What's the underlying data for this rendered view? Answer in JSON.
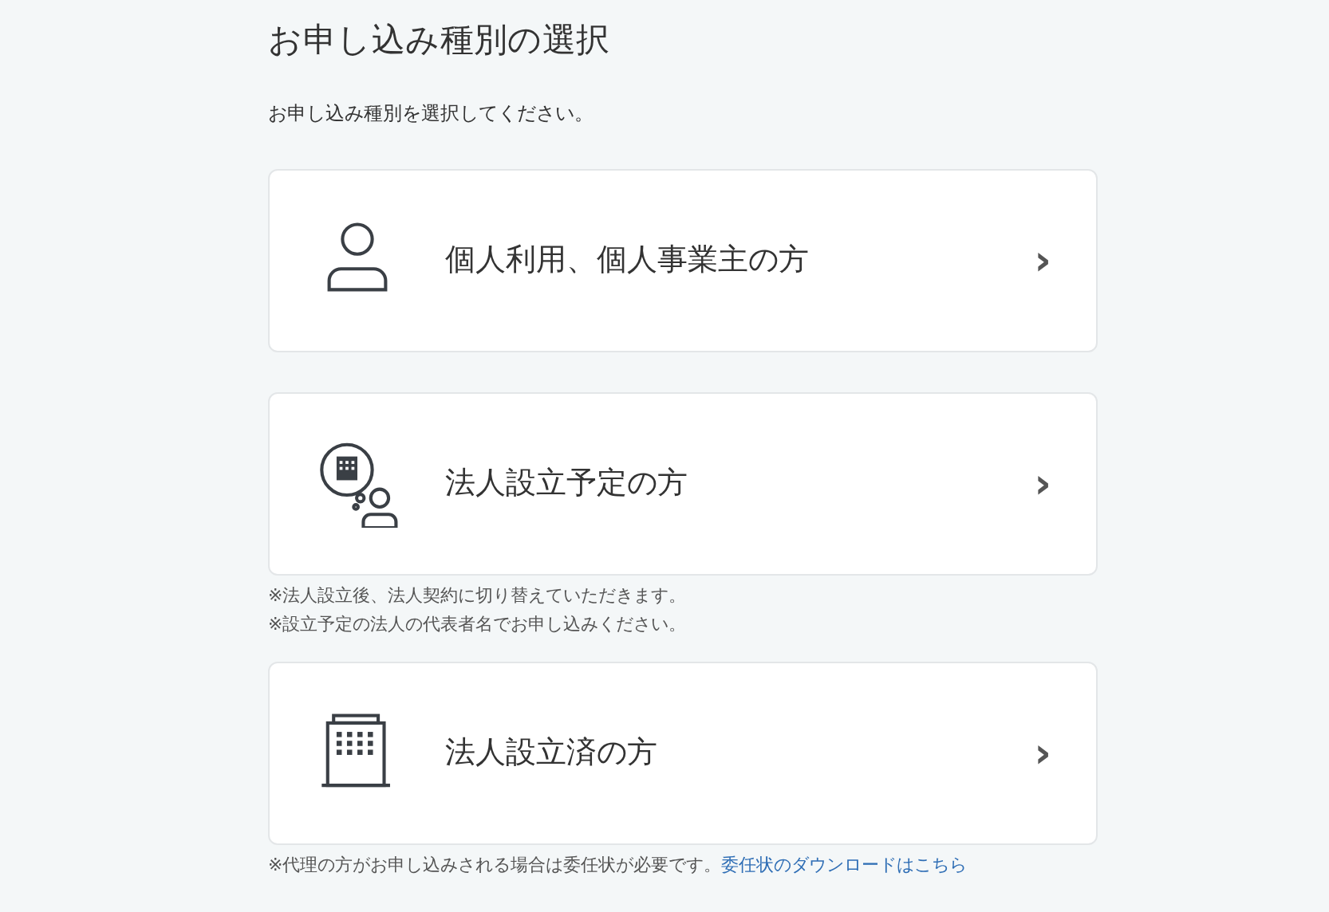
{
  "title": "お申し込み種別の選択",
  "intro": "お申し込み種別を選択してください。",
  "options": [
    {
      "kind": "person",
      "label": "個人利用、個人事業主の方",
      "chevron": "›"
    },
    {
      "kind": "planned-company",
      "label": "法人設立予定の方",
      "chevron": "›",
      "notes": [
        {
          "text": "※法人設立後、法人契約に切り替えていただきます。"
        },
        {
          "text": "※設立予定の法人の代表者名でお申し込みください。"
        }
      ]
    },
    {
      "kind": "company",
      "label": "法人設立済の方",
      "chevron": "›",
      "notes": [
        {
          "text": "※代理の方がお申し込みされる場合は委任状が必要です。",
          "link": "委任状のダウンロードはこちら"
        }
      ]
    }
  ]
}
